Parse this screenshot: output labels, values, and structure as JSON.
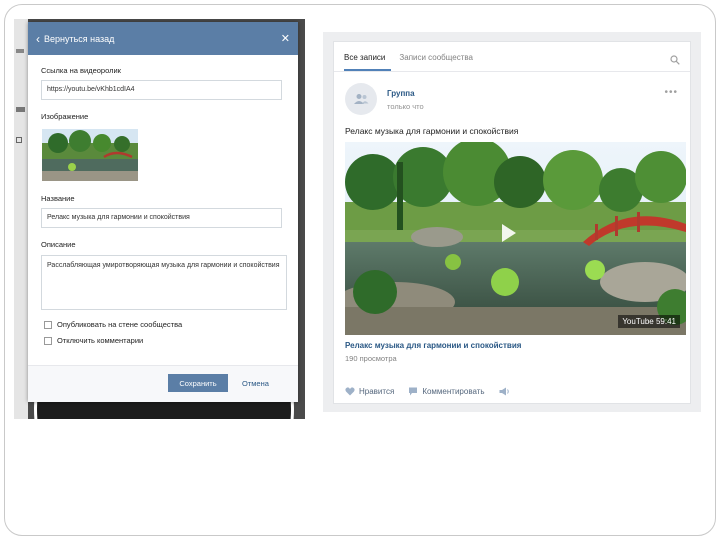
{
  "left_modal": {
    "header_back": "Вернуться назад",
    "close_glyph": "✕",
    "link_label": "Ссылка на видеоролик",
    "link_value": "https://youtu.be/vKhb1cdIA4",
    "image_label": "Изображение",
    "name_label": "Название",
    "name_value": "Релакс музыка для гармонии и спокойствия",
    "desc_label": "Описание",
    "desc_value": "Расслабляющая умиротворяющая музыка для гармонии и спокойствия",
    "checkbox1": "Опубликовать на стене сообщества",
    "checkbox2": "Отключить комментарии",
    "save": "Сохранить",
    "cancel": "Отмена"
  },
  "right_post": {
    "tab_all": "Все записи",
    "tab_community": "Записи сообщества",
    "author": "Группа",
    "time": "только что",
    "text": "Релакс музыка для гармонии и спокойствия",
    "yt_badge": "YouTube  59:41",
    "video_title": "Релакс музыка для гармонии и спокойствия",
    "views": "190 просмотра",
    "like": "Нравится",
    "comment": "Комментировать"
  },
  "colors": {
    "vk_blue": "#5b7ea6",
    "link_blue": "#2a5885"
  },
  "icons": [
    "back-arrow-icon",
    "close-icon",
    "search-icon",
    "group-avatar-icon",
    "more-icon",
    "play-icon",
    "heart-icon",
    "comment-icon",
    "share-icon"
  ]
}
